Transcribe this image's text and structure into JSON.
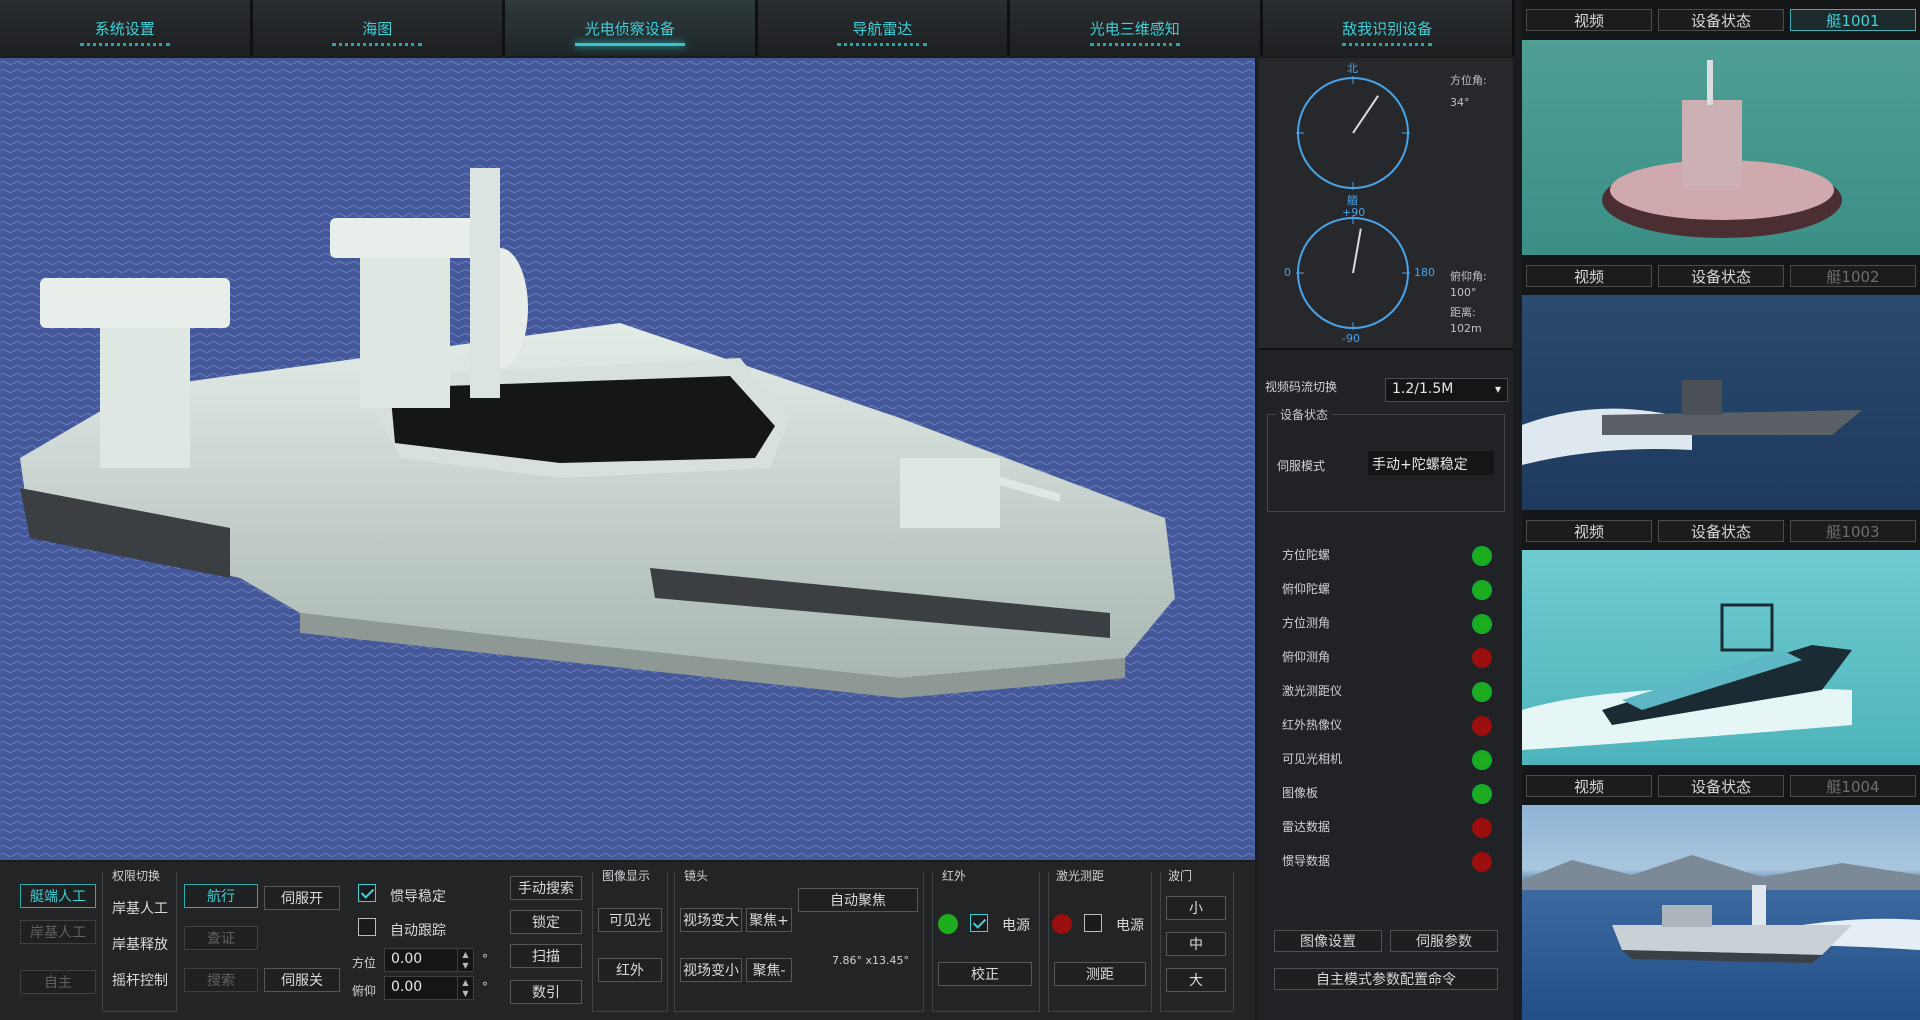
{
  "tabs": [
    {
      "label": "系统设置",
      "active": false
    },
    {
      "label": "海图",
      "active": false
    },
    {
      "label": "光电侦察设备",
      "active": true
    },
    {
      "label": "导航雷达",
      "active": false
    },
    {
      "label": "光电三维感知",
      "active": false
    },
    {
      "label": "敌我识别设备",
      "active": false
    }
  ],
  "gauges": {
    "top_tick": "北",
    "bottom_tick": "0",
    "left_tick": "0",
    "right_tick": "180",
    "plus90": "+90",
    "minus90": "-90",
    "bottom2": "艏",
    "azimuth_label": "方位角:",
    "azimuth_value": "34°",
    "pitch_label": "俯仰角:",
    "pitch_value": "100°",
    "distance_label": "距离:",
    "distance_value": "102m"
  },
  "stream": {
    "label": "视频码流切换",
    "value": "1.2/1.5M"
  },
  "device": {
    "legend": "设备状态",
    "mode_label": "伺服模式",
    "mode_value": "手动+陀螺稳定"
  },
  "status": [
    {
      "label": "方位陀螺",
      "state": "ok"
    },
    {
      "label": "俯仰陀螺",
      "state": "ok"
    },
    {
      "label": "方位测角",
      "state": "ok"
    },
    {
      "label": "俯仰测角",
      "state": "err"
    },
    {
      "label": "激光测距仪",
      "state": "ok"
    },
    {
      "label": "红外热像仪",
      "state": "err"
    },
    {
      "label": "可见光相机",
      "state": "ok"
    },
    {
      "label": "图像板",
      "state": "ok"
    },
    {
      "label": "雷达数据",
      "state": "err"
    },
    {
      "label": "惯导数据",
      "state": "err"
    }
  ],
  "right_buttons": {
    "image_settings": "图像设置",
    "servo_params": "伺服参数",
    "auto_cfg": "自主模式参数配置命令"
  },
  "thumbs": [
    {
      "video": "视频",
      "status": "设备状态",
      "boat": "艇1001",
      "active": true
    },
    {
      "video": "视频",
      "status": "设备状态",
      "boat": "艇1002",
      "active": false
    },
    {
      "video": "视频",
      "status": "设备状态",
      "boat": "艇1003",
      "active": false
    },
    {
      "video": "视频",
      "status": "设备状态",
      "boat": "艇1004",
      "active": false
    }
  ],
  "controls": {
    "boat_manual": "艇端人工",
    "shore_manual_dis": "岸基人工",
    "autonomous": "自主",
    "perm_title": "权限切换",
    "perm_shore_manual": "岸基人工",
    "perm_shore_release": "岸基释放",
    "perm_joystick": "摇杆控制",
    "sail": "航行",
    "verify": "查证",
    "search": "搜索",
    "servo_on": "伺服开",
    "servo_off": "伺服关",
    "inertial": "惯导稳定",
    "auto_track": "自动跟踪",
    "az_label": "方位",
    "az_value": "0.00",
    "pitch_label": "俯仰",
    "pitch_value": "0.00",
    "deg": "°",
    "manual_search": "手动搜索",
    "lock": "锁定",
    "scan": "扫描",
    "guide": "数引",
    "img_title": "图像显示",
    "visible": "可见光",
    "infrared": "红外",
    "lens_title": "镜头",
    "auto_focus": "自动聚焦",
    "fov_zoom_in": "视场变大",
    "focus_plus": "聚焦+",
    "fov_zoom_out": "视场变小",
    "focus_minus": "聚焦-",
    "fov_value": "7.86° x13.45°",
    "ir_title": "红外",
    "ir_power": "电源",
    "ir_calib": "校正",
    "laser_title": "激光测距",
    "laser_power": "电源",
    "laser_range": "测距",
    "gate_title": "波门",
    "gate_small": "小",
    "gate_mid": "中",
    "gate_large": "大"
  },
  "colors": {
    "accent": "#3fd0d8",
    "ok": "#1dac1d",
    "err": "#9b0e0e",
    "gauge": "#4aa3e8"
  },
  "gauge_values": {
    "azimuth_deg": 34,
    "pitch_needle_deg": 10
  }
}
